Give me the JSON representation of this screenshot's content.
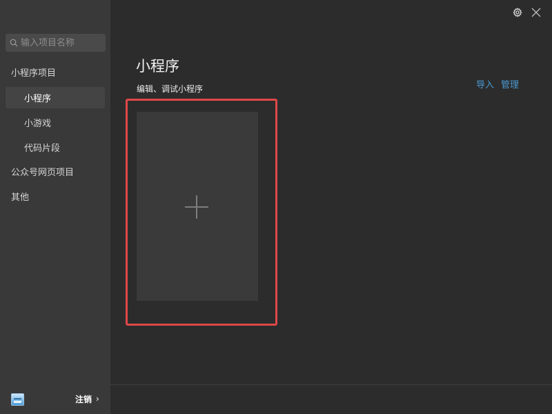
{
  "sidebar": {
    "search_placeholder": "输入项目名称",
    "items": [
      {
        "label": "小程序项目",
        "level": "top",
        "active": false
      },
      {
        "label": "小程序",
        "level": "sub",
        "active": true
      },
      {
        "label": "小游戏",
        "level": "sub",
        "active": false
      },
      {
        "label": "代码片段",
        "level": "sub",
        "active": false
      },
      {
        "label": "公众号网页项目",
        "level": "top",
        "active": false
      },
      {
        "label": "其他",
        "level": "top",
        "active": false
      }
    ],
    "logout_label": "注销"
  },
  "main": {
    "title": "小程序",
    "subtitle": "编辑、调试小程序",
    "actions": {
      "import_label": "导入",
      "manage_label": "管理"
    }
  },
  "colors": {
    "sidebar_bg": "#393939",
    "main_bg": "#2c2c2c",
    "link": "#4a9bd4",
    "highlight": "#e04848"
  },
  "icons": {
    "search": "search-icon",
    "settings": "gear-icon",
    "close": "close-icon",
    "add": "plus-icon",
    "avatar": "avatar-icon",
    "chevron": "chevron-right-icon"
  }
}
